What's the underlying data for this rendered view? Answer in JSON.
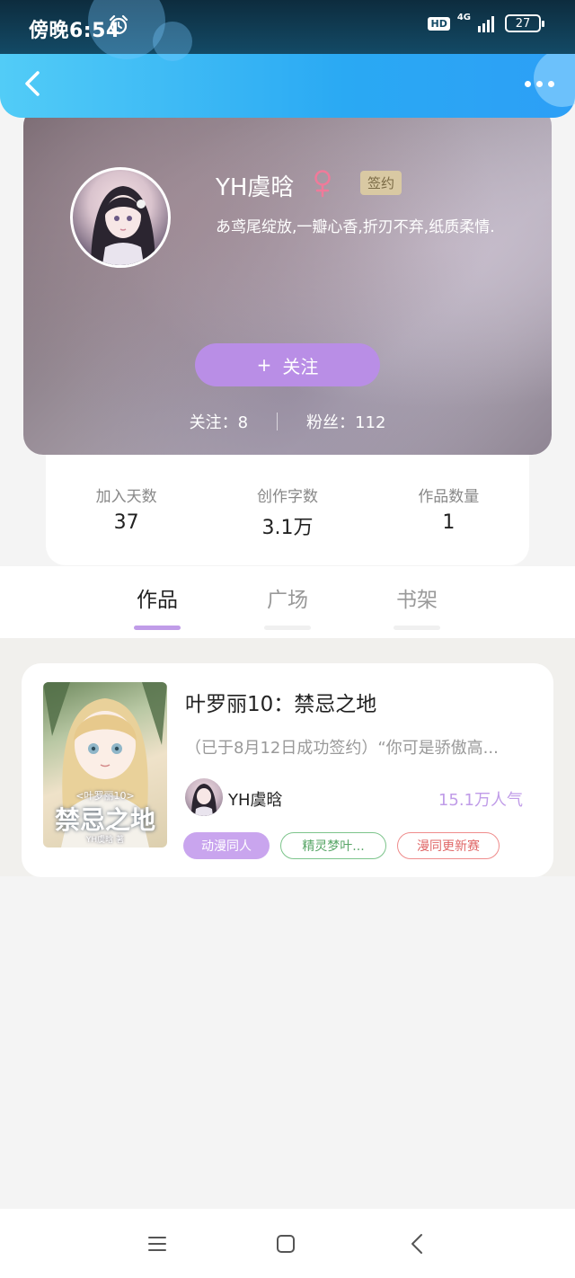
{
  "status_bar": {
    "time": "傍晚6:54",
    "hd": "HD",
    "network": "4G",
    "battery": "27",
    "icons": [
      "alarm-icon",
      "signal-icon",
      "battery-icon"
    ]
  },
  "header": {
    "back_icon": "back-arrow-icon",
    "more_icon": "more-dots-icon",
    "colors": {
      "gradient_start": "#52ccf7",
      "gradient_end": "#2d9ff6"
    }
  },
  "profile": {
    "name": "YH虞晗",
    "gender_icon": "female-icon",
    "badge": "签约",
    "signature": "あ鸢尾绽放,一瓣心香,折刃不弃,纸质柔情.",
    "follow_button": {
      "icon": "+",
      "label": "关注"
    },
    "following": "关注：8",
    "followers": "粉丝：112"
  },
  "stats": [
    {
      "label": "加入天数",
      "value": "37"
    },
    {
      "label": "创作字数",
      "value": "3.1万"
    },
    {
      "label": "作品数量",
      "value": "1"
    }
  ],
  "tabs": [
    {
      "label": "作品",
      "active": true
    },
    {
      "label": "广场",
      "active": false
    },
    {
      "label": "书架",
      "active": false
    }
  ],
  "works": [
    {
      "title": "叶罗丽10：禁忌之地",
      "description": "（已于8月12日成功签约）“你可是骄傲高...",
      "author": "YH虞晗",
      "popularity": "15.1万人气",
      "cover_text": {
        "subtitle": "<叶罗丽10>",
        "title": "禁忌之地",
        "author": "YH虞晗 著"
      },
      "tags": [
        "动漫同人",
        "精灵梦叶...",
        "漫同更新赛"
      ]
    }
  ],
  "accent_color": "#c09ce8",
  "bottom_nav": [
    "menu-icon",
    "home-icon",
    "back-icon"
  ]
}
